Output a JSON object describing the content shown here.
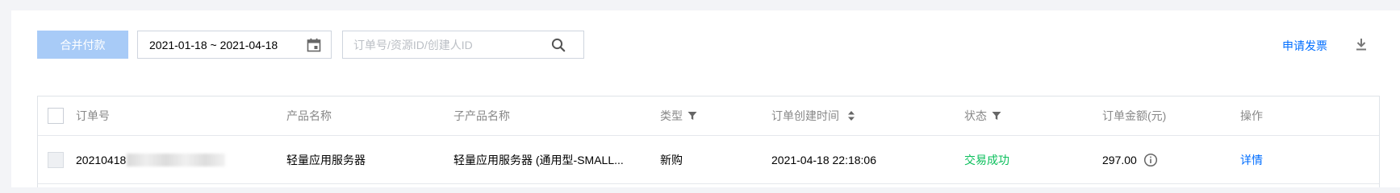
{
  "toolbar": {
    "merge_pay_label": "合并付款",
    "date_range_value": "2021-01-18 ~ 2021-04-18",
    "search_placeholder": "订单号/资源ID/创建人ID",
    "invoice_label": "申请发票"
  },
  "icons": {
    "calendar": "calendar-icon",
    "search": "search-icon",
    "download": "download-icon",
    "filter": "filter-icon",
    "sort": "sort-icon",
    "info": "info-icon"
  },
  "colors": {
    "accent": "#006eff",
    "primary_disabled": "#a8cbf7",
    "success": "#0abf5b",
    "header_text": "#888888"
  },
  "table": {
    "headers": {
      "order_no": "订单号",
      "product_name": "产品名称",
      "sub_product_name": "子产品名称",
      "type": "类型",
      "created_time": "订单创建时间",
      "status": "状态",
      "amount": "订单金额(元)",
      "actions": "操作"
    },
    "rows": [
      {
        "order_no": "20210418",
        "product_name": "轻量应用服务器",
        "sub_product_name": "轻量应用服务器 (通用型-SMALL...",
        "type": "新购",
        "created_time": "2021-04-18 22:18:06",
        "status": "交易成功",
        "amount": "297.00",
        "action_label": "详情"
      }
    ]
  }
}
